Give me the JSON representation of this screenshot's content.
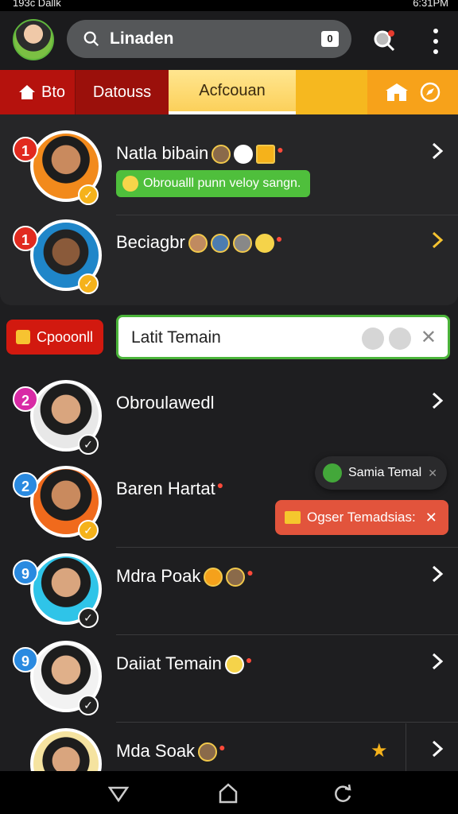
{
  "status": {
    "time_left": "193c Dallk",
    "time_right": "6:31PM"
  },
  "search": {
    "value": "Linaden",
    "badge": "0"
  },
  "tabs": [
    {
      "label": "Bto"
    },
    {
      "label": "Datouss"
    },
    {
      "label": "Acfcouan"
    }
  ],
  "contacts": [
    {
      "badge": "1",
      "name": "Natla bibain",
      "bubble": "Obroualll punn veloy sangn."
    },
    {
      "badge": "1",
      "name": "Beciagbr"
    },
    {
      "badge": "2",
      "name": "Obroulawedl"
    },
    {
      "badge": "2",
      "name": "Baren Hartat"
    },
    {
      "badge": "9",
      "name": "Mdra Poak"
    },
    {
      "badge": "9",
      "name": "Daiiat Temain"
    },
    {
      "name": "Mda Soak"
    }
  ],
  "pill": {
    "label": "Cpooonll"
  },
  "field": {
    "value": "Latit Temain"
  },
  "toasts": {
    "dark": "Samia Temal",
    "red": "Ogser Temadsias:"
  },
  "colors": {
    "accent_red": "#d2190f",
    "accent_yellow": "#fcd05a",
    "green": "#4fbf3c"
  }
}
